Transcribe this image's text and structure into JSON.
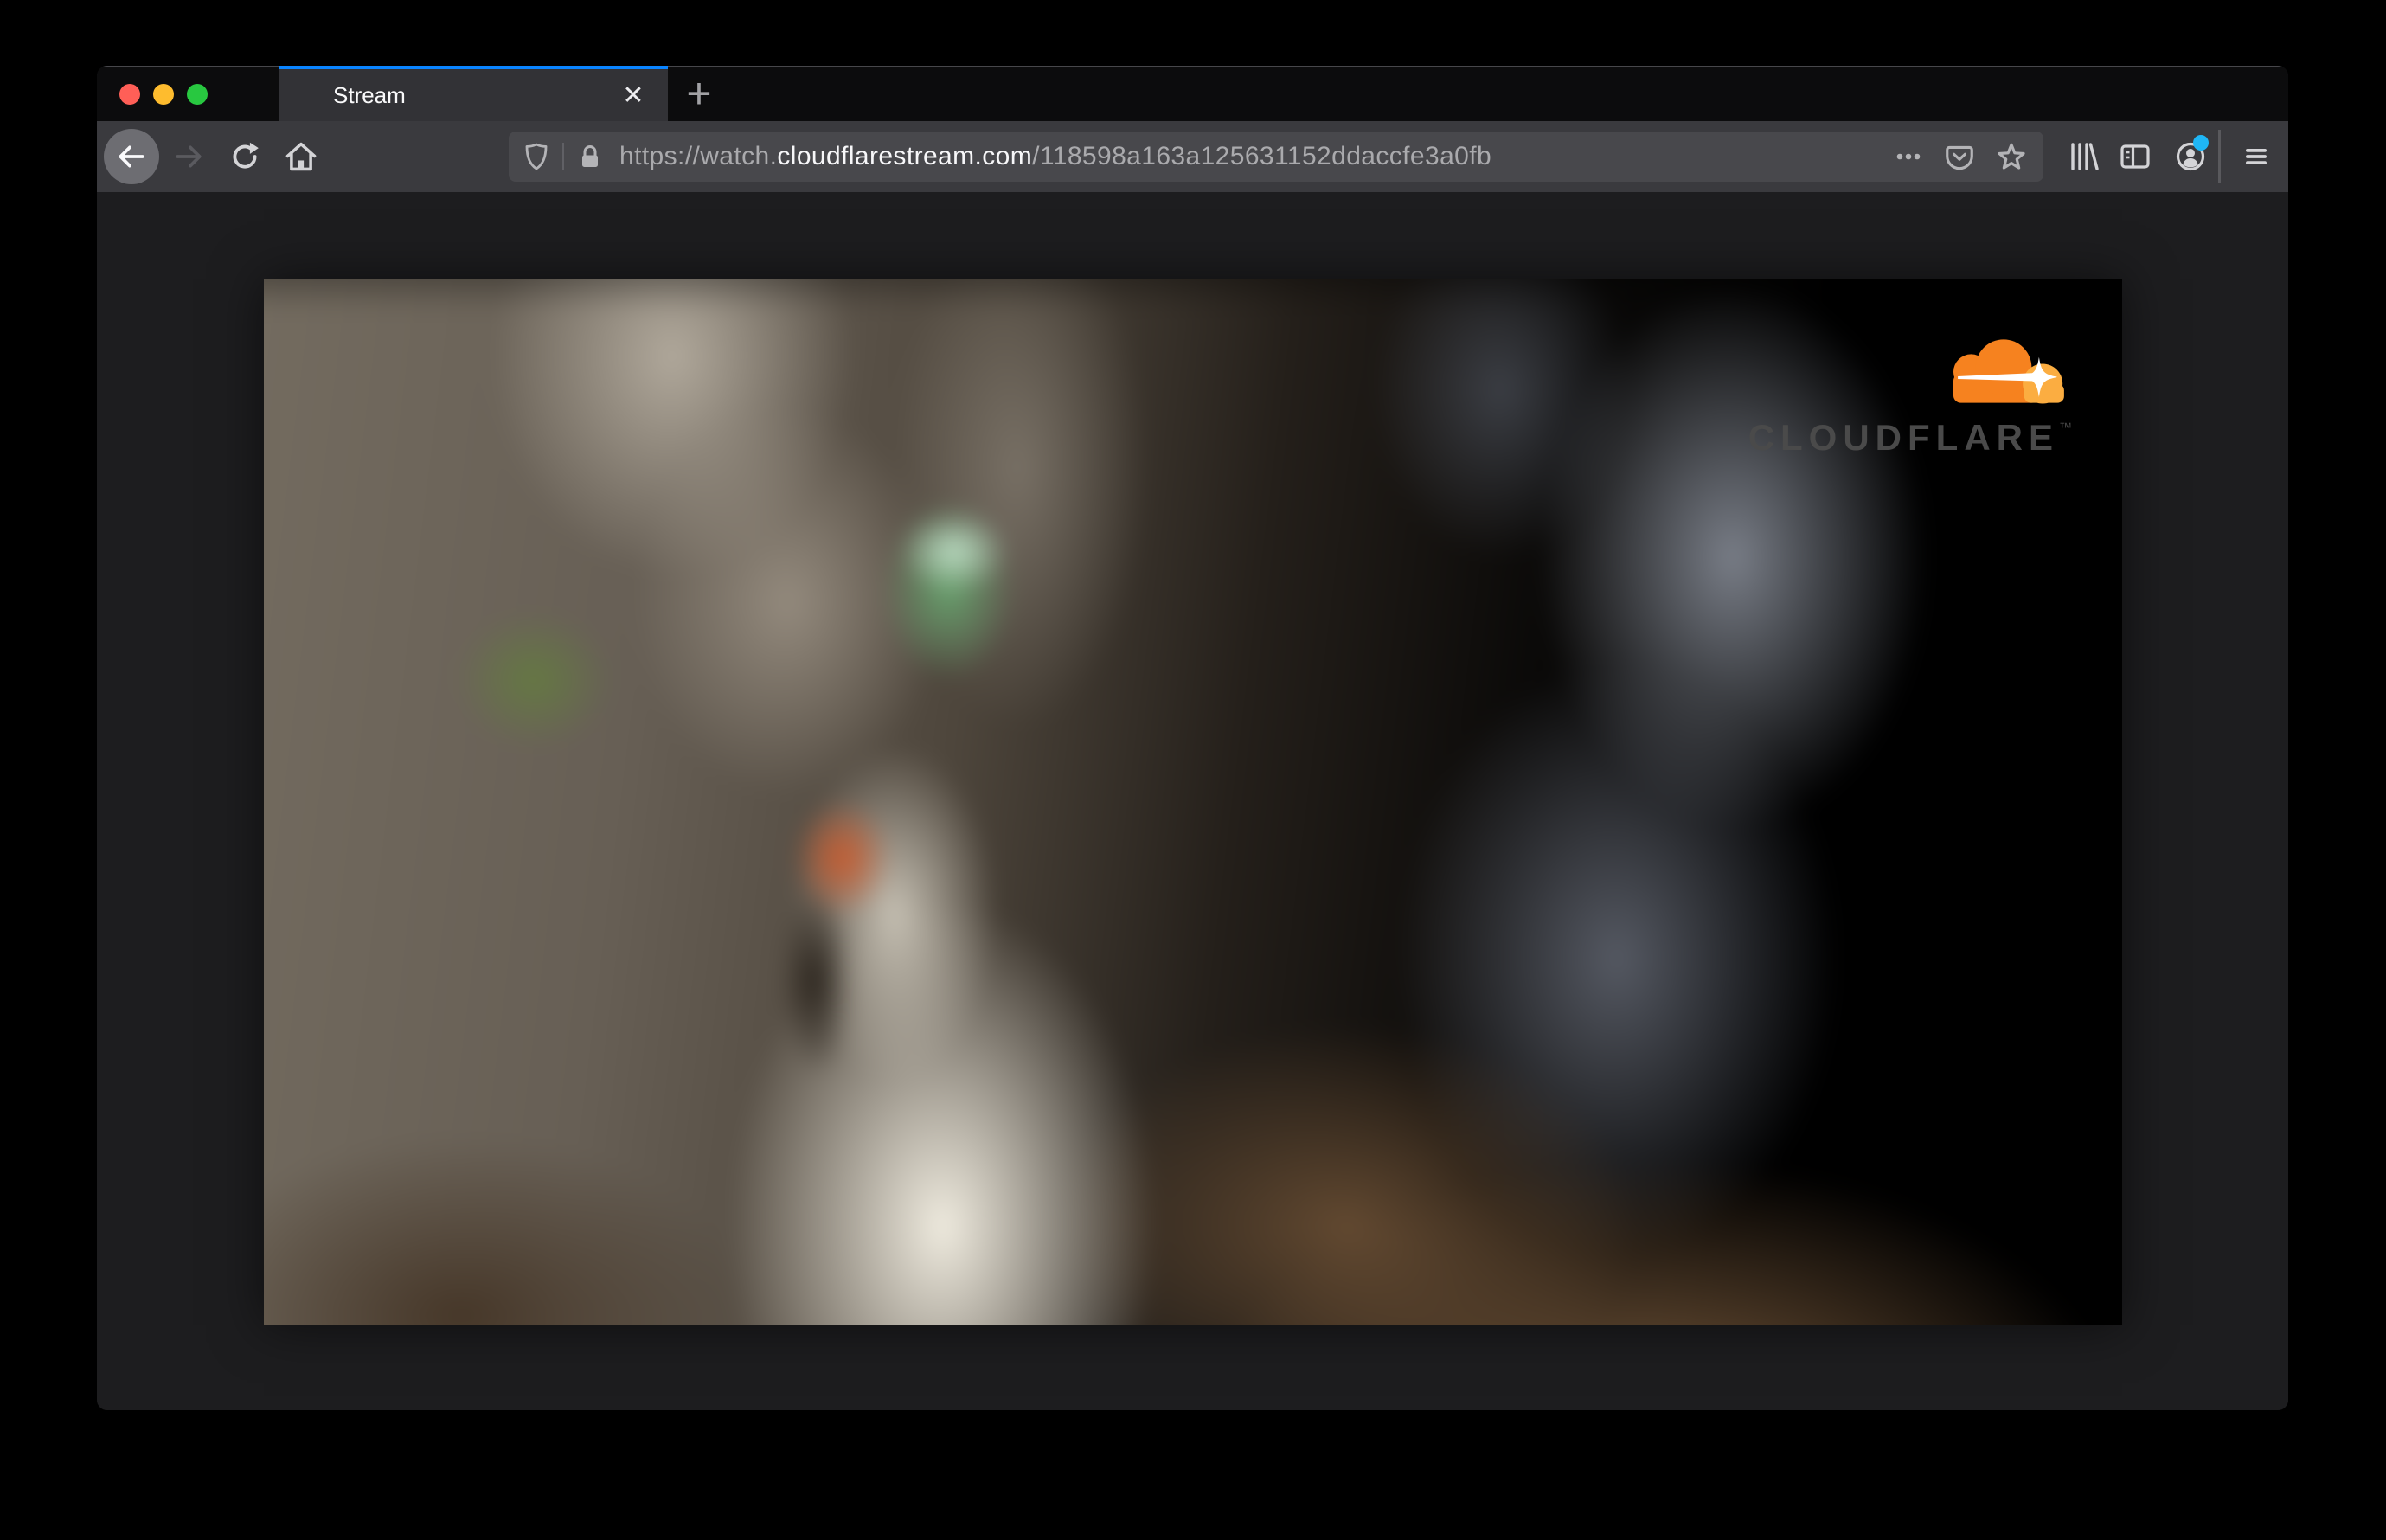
{
  "browser": {
    "traffic_lights": {
      "close_color": "#ff5f57",
      "minimize_color": "#febc2e",
      "zoom_color": "#28c840"
    },
    "tab": {
      "title": "Stream",
      "close_glyph": "✕",
      "accent_color": "#0a84ff"
    },
    "new_tab_glyph": "+",
    "address_bar": {
      "scheme_subdomain": "https://watch.",
      "domain": "cloudflarestream.com",
      "path": "/118598a163a125631152ddaccfe3a0fb"
    },
    "account_notification_dot_color": "#1fb6f5",
    "icons": {
      "back": "arrow-left-in-circle",
      "forward": "arrow-right",
      "reload": "circular-arrow",
      "home": "house",
      "tracking_protection": "shield",
      "connection_secure": "lock",
      "page_actions": "three-dots",
      "save_to_pocket": "pocket",
      "bookmark": "star",
      "library": "books",
      "sidebar": "split-panel",
      "account": "person-in-circle",
      "menu": "hamburger"
    }
  },
  "page_content": {
    "video_player": {
      "description": "blurry close-up of a gray tabby cat with green eyes",
      "brand": {
        "text": "CLOUDFLARE",
        "trademark": "™",
        "cloud_orange": "#f6821f",
        "cloud_light_orange": "#fbad41",
        "text_color": "#4a4a4a"
      }
    }
  }
}
